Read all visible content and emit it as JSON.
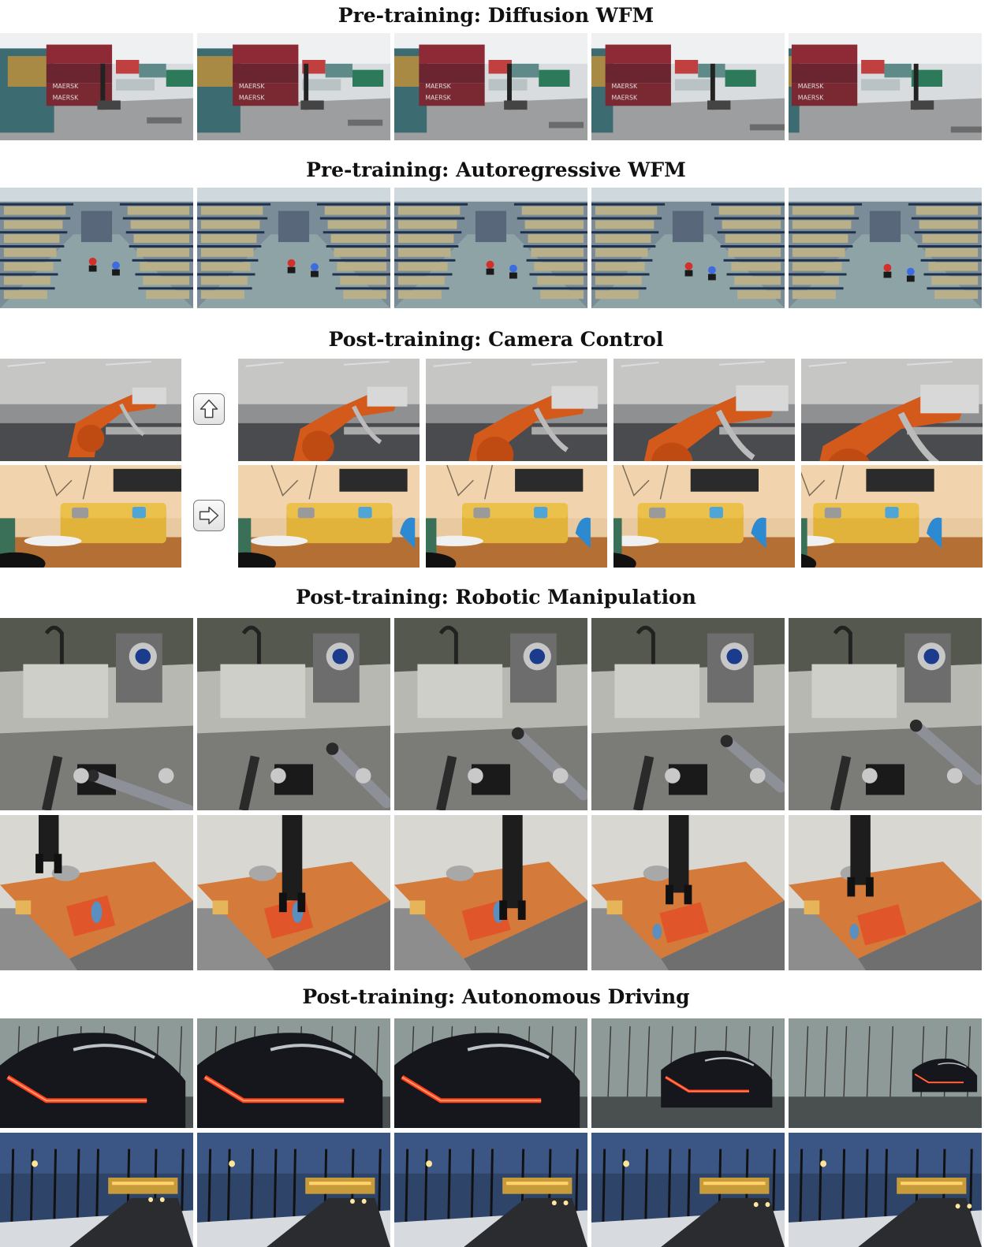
{
  "sections": [
    {
      "title": "Pre-training: Diffusion WFM",
      "scene": "port-containers"
    },
    {
      "title": "Pre-training: Autoregressive WFM",
      "scene": "warehouse-aisle"
    },
    {
      "title": "Post-training: Camera Control",
      "scenes": [
        "factory-robot-arm",
        "living-room-sofa"
      ],
      "arrows": [
        "up-arrow-icon",
        "right-arrow-icon"
      ]
    },
    {
      "title": "Post-training: Robotic Manipulation",
      "scenes": [
        "kitchen-egocentric-arms",
        "robot-gripper-table"
      ]
    },
    {
      "title": "Post-training: Autonomous Driving",
      "scenes": [
        "car-taillights-night",
        "wet-road-dusk"
      ]
    }
  ],
  "frames_per_row": 5,
  "colors": {
    "container-red": "#8e2a36",
    "robot-orange": "#d45a1c",
    "sofa-yellow": "#e2b33a",
    "taillight-red": "#ff3b1a",
    "board-orange": "#d47a3a"
  }
}
